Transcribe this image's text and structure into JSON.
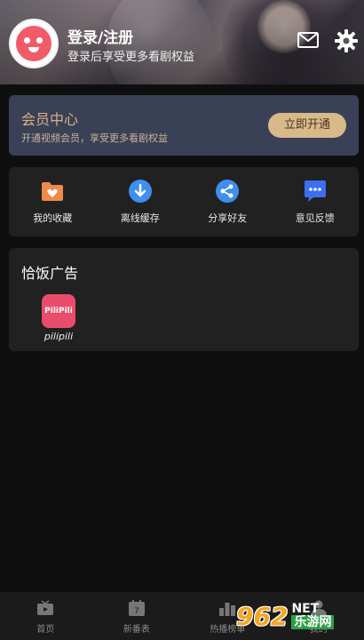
{
  "header": {
    "login_title": "登录/注册",
    "login_subtitle": "登录后享受更多看剧权益",
    "mail_icon": "mail-icon",
    "settings_icon": "gear-icon"
  },
  "vip": {
    "title": "会员中心",
    "subtitle": "开通视频会员，享受更多看剧权益",
    "button": "立即开通",
    "accent": "#d8b98a"
  },
  "actions": [
    {
      "label": "我的收藏",
      "icon": "favorite-folder-icon",
      "color": "#f08a4b"
    },
    {
      "label": "离线缓存",
      "icon": "download-icon",
      "color": "#3f8ef0"
    },
    {
      "label": "分享好友",
      "icon": "share-icon",
      "color": "#3f8ef0"
    },
    {
      "label": "意见反馈",
      "icon": "feedback-icon",
      "color": "#3d6ef0"
    }
  ],
  "ads": {
    "title": "恰饭广告",
    "items": [
      {
        "label": "pilipili",
        "logo_text": "PiliPili"
      }
    ]
  },
  "bottom_nav": [
    {
      "label": "首页",
      "icon": "tv-icon"
    },
    {
      "label": "新番表",
      "icon": "calendar-icon"
    },
    {
      "label": "热播榜单",
      "icon": "ranking-icon"
    },
    {
      "label": "我的",
      "icon": "user-icon"
    }
  ],
  "watermark": {
    "number": "962",
    "suffix": "NET",
    "text": "乐游网"
  }
}
